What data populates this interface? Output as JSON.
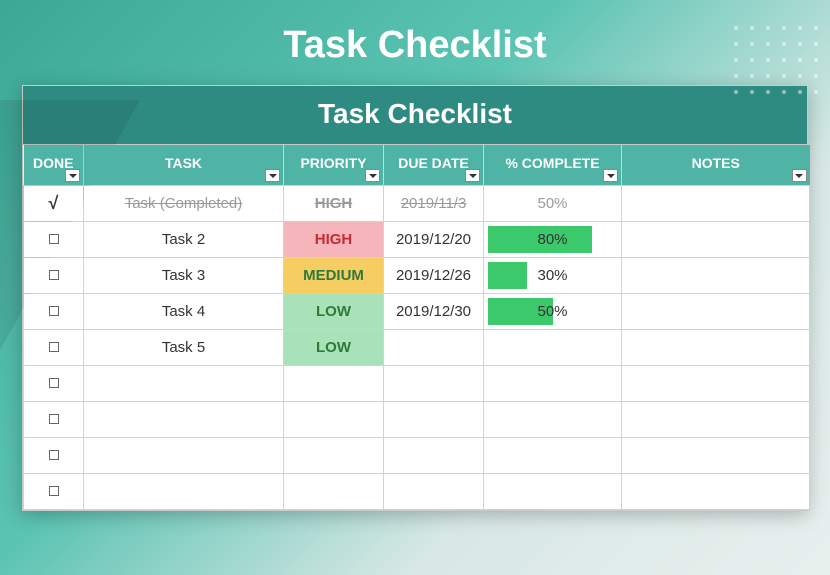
{
  "page_title": "Task Checklist",
  "sheet_title": "Task Checklist",
  "columns": {
    "done": "DONE",
    "task": "TASK",
    "priority": "PRIORITY",
    "due_date": "DUE DATE",
    "complete": "% COMPLETE",
    "notes": "NOTES"
  },
  "rows": [
    {
      "done": true,
      "task": "Task (Completed)",
      "priority": "HIGH",
      "due_date": "2019/11/3",
      "complete": "50%",
      "complete_pct": 50,
      "notes": ""
    },
    {
      "done": false,
      "task": "Task 2",
      "priority": "HIGH",
      "due_date": "2019/12/20",
      "complete": "80%",
      "complete_pct": 80,
      "notes": ""
    },
    {
      "done": false,
      "task": "Task 3",
      "priority": "MEDIUM",
      "due_date": "2019/12/26",
      "complete": "30%",
      "complete_pct": 30,
      "notes": ""
    },
    {
      "done": false,
      "task": "Task 4",
      "priority": "LOW",
      "due_date": "2019/12/30",
      "complete": "50%",
      "complete_pct": 50,
      "notes": ""
    },
    {
      "done": false,
      "task": "Task 5",
      "priority": "LOW",
      "due_date": "",
      "complete": "",
      "complete_pct": 0,
      "notes": ""
    },
    {
      "done": false,
      "task": "",
      "priority": "",
      "due_date": "",
      "complete": "",
      "complete_pct": 0,
      "notes": ""
    },
    {
      "done": false,
      "task": "",
      "priority": "",
      "due_date": "",
      "complete": "",
      "complete_pct": 0,
      "notes": ""
    },
    {
      "done": false,
      "task": "",
      "priority": "",
      "due_date": "",
      "complete": "",
      "complete_pct": 0,
      "notes": ""
    },
    {
      "done": false,
      "task": "",
      "priority": "",
      "due_date": "",
      "complete": "",
      "complete_pct": 0,
      "notes": ""
    }
  ]
}
